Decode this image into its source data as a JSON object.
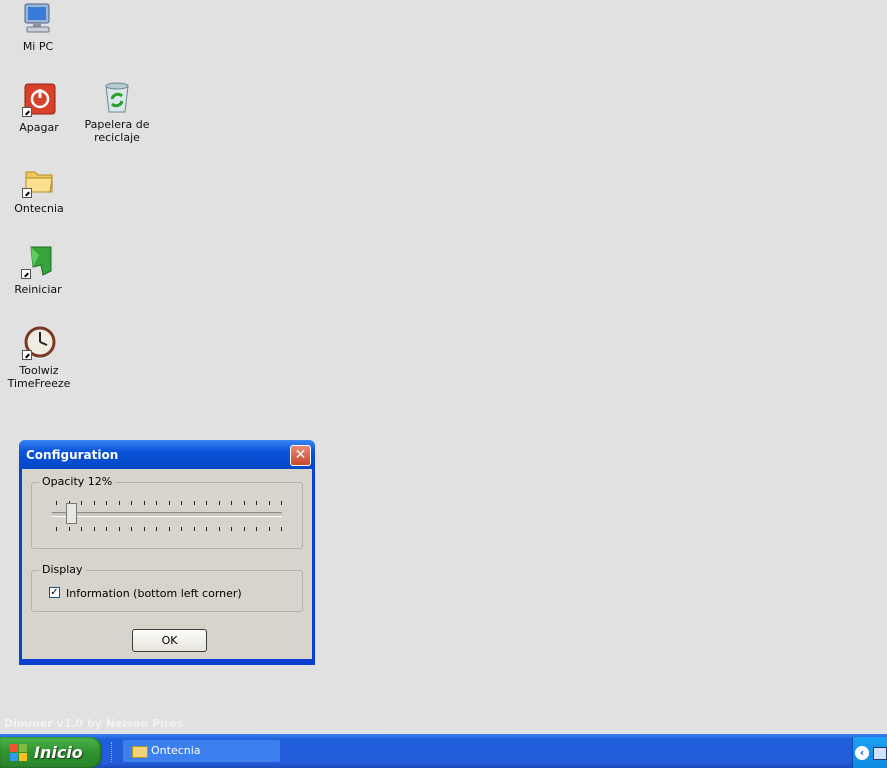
{
  "desktop": {
    "icons": [
      {
        "label": "Mi PC"
      },
      {
        "label": "Apagar"
      },
      {
        "label": "Papelera de reciclaje"
      },
      {
        "label": "Ontecnia"
      },
      {
        "label": "Reiniciar"
      },
      {
        "label": "Toolwiz TimeFreeze"
      }
    ],
    "watermark": "Dimmer v1.0 by Nelson Pires"
  },
  "dialog": {
    "title": "Configuration",
    "opacity_label": "Opacity 12%",
    "opacity_value": 12,
    "display_label": "Display",
    "info_checkbox_label": "Information (bottom left corner)",
    "info_checked": true,
    "ok_label": "OK"
  },
  "taskbar": {
    "start_label": "Inicio",
    "task_label": "Ontecnia"
  },
  "colors": {
    "titlebar": "#0a52d8",
    "start_button": "#2f922f",
    "taskbar": "#245ddb"
  }
}
